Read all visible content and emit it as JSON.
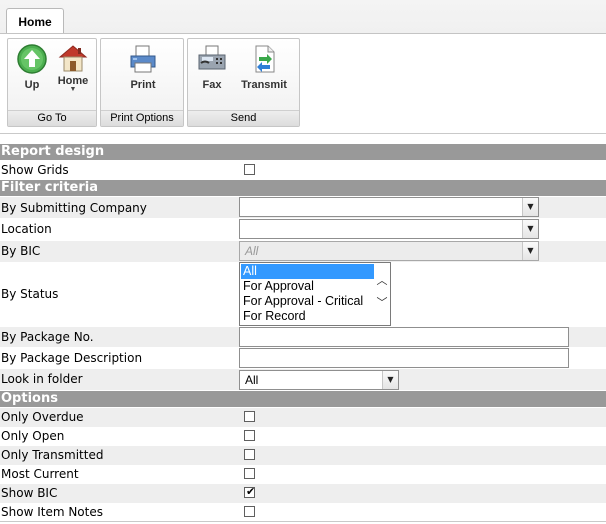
{
  "ribbon": {
    "tab": "Home",
    "groups": [
      {
        "label": "Go To",
        "buttons": [
          {
            "label": "Up",
            "icon": "up-arrow-icon"
          },
          {
            "label": "Home",
            "icon": "home-icon"
          }
        ]
      },
      {
        "label": "Print Options",
        "buttons": [
          {
            "label": "Print",
            "icon": "printer-icon"
          }
        ]
      },
      {
        "label": "Send",
        "buttons": [
          {
            "label": "Fax",
            "icon": "fax-icon"
          },
          {
            "label": "Transmit",
            "icon": "transmit-icon"
          }
        ]
      }
    ]
  },
  "report_design": {
    "header": "Report design",
    "show_grids": {
      "label": "Show Grids",
      "checked": false
    }
  },
  "filter": {
    "header": "Filter criteria",
    "submitting_company": {
      "label": "By Submitting Company",
      "value": ""
    },
    "location": {
      "label": "Location",
      "value": ""
    },
    "bic": {
      "label": "By BIC",
      "value": "All"
    },
    "status": {
      "label": "By Status",
      "options": [
        "All",
        "For Approval",
        "For Approval - Critical",
        "For Record"
      ],
      "selected": "All"
    },
    "package_no": {
      "label": "By Package No.",
      "value": ""
    },
    "package_description": {
      "label": "By Package Description",
      "value": ""
    },
    "look_in_folder": {
      "label": "Look in folder",
      "value": "All"
    }
  },
  "options": {
    "header": "Options",
    "only_overdue": {
      "label": "Only Overdue",
      "checked": false
    },
    "only_open": {
      "label": "Only Open",
      "checked": false
    },
    "only_transmitted": {
      "label": "Only Transmitted",
      "checked": false
    },
    "most_current": {
      "label": "Most Current",
      "checked": false
    },
    "show_bic": {
      "label": "Show BIC",
      "checked": true
    },
    "show_item_notes": {
      "label": "Show Item Notes",
      "checked": false
    }
  },
  "colors": {
    "section_header": "#999999",
    "alt_row": "#eeeeee",
    "selection": "#3399ff",
    "up_icon": "#4caf50",
    "home_roof": "#c0392b"
  }
}
